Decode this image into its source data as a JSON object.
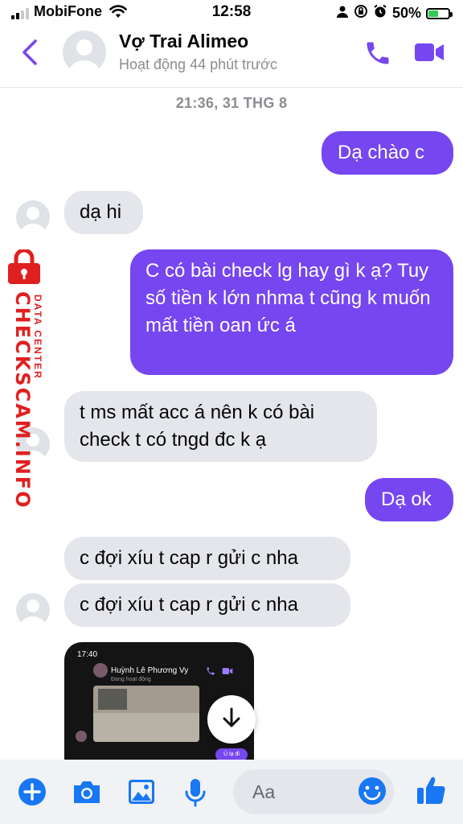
{
  "status_bar": {
    "carrier": "MobiFone",
    "time": "12:58",
    "battery": "50%"
  },
  "header": {
    "contact_name": "Vợ Trai Alimeo",
    "contact_status": "Hoạt động 44 phút trước"
  },
  "timestamp": "21:36, 31 THG 8",
  "messages": [
    {
      "from": "me",
      "text": "Dạ chào c"
    },
    {
      "from": "them",
      "text": "dạ hi"
    },
    {
      "from": "me",
      "text": "C có bài check lg hay gì k ạ? Tuy số tiền k lớn nhma t cũng k muốn mất tiền oan ức á"
    },
    {
      "from": "them",
      "text": "t ms mất acc á nên k có bài check t có tngd đc k ạ"
    },
    {
      "from": "me",
      "text": "Dạ ok"
    },
    {
      "from": "them",
      "text": "c đợi xíu t cap r gửi c nha"
    },
    {
      "from": "them",
      "text": "c đợi xíu t cap r gửi c nha"
    }
  ],
  "attachment": {
    "time": "17:40",
    "name": "Huỳnh Lê Phương Vy",
    "status": "Đang hoạt động",
    "pill": "Ủ lạ đi"
  },
  "watermark": {
    "main": "CHECKSCAM.INFO",
    "sub": "DATA CENTER"
  },
  "composer": {
    "placeholder": "Aa"
  },
  "colors": {
    "accent": "#7646f0",
    "received_bubble": "#e4e6eb",
    "composer_icons": "#1877f2"
  }
}
